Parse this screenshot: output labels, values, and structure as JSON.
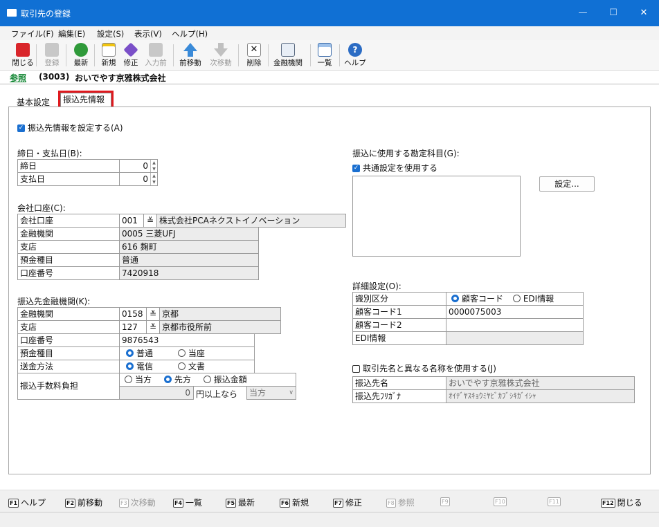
{
  "window": {
    "title": "取引先の登録"
  },
  "menu": [
    "ファイル(F)",
    "編集(E)",
    "設定(S)",
    "表示(V)",
    "ヘルプ(H)"
  ],
  "toolbar": [
    {
      "label": "閉じる",
      "icon": "close-icon",
      "color": "#d9262b",
      "enabled": true
    },
    {
      "label": "登録",
      "icon": "register-icon",
      "color": "#b8b8b8",
      "enabled": false
    },
    {
      "label": "最新",
      "icon": "refresh-icon",
      "color": "#2f9a3a",
      "enabled": true
    },
    {
      "label": "新規",
      "icon": "new-icon",
      "color": "#f1c40f",
      "enabled": true
    },
    {
      "label": "修正",
      "icon": "edit-icon",
      "color": "#7a4fc8",
      "enabled": true
    },
    {
      "label": "入力前",
      "icon": "undo-icon",
      "color": "#b8b8b8",
      "enabled": false
    },
    {
      "label": "前移動",
      "icon": "up-arrow-icon",
      "color": "#3a8ad8",
      "enabled": true
    },
    {
      "label": "次移動",
      "icon": "down-arrow-icon",
      "color": "#b8b8b8",
      "enabled": false
    },
    {
      "label": "削除",
      "icon": "delete-icon",
      "color": "#555555",
      "enabled": true
    },
    {
      "label": "金融機関",
      "icon": "bank-icon",
      "color": "#5a6a80",
      "enabled": true
    },
    {
      "label": "一覧",
      "icon": "list-icon",
      "color": "#3a6aa8",
      "enabled": true
    },
    {
      "label": "ヘルプ",
      "icon": "help-icon",
      "color": "#2b6cc4",
      "enabled": true
    }
  ],
  "ref": {
    "label": "参照",
    "code": "(3003)",
    "name": "おいでやす京雅株式会社"
  },
  "tabs": [
    "基本設定",
    "振込先情報"
  ],
  "enable_transfer": "振込先情報を設定する(A)",
  "closing": {
    "title": "締日・支払日(B):",
    "rows": [
      {
        "label": "締日",
        "value": "0"
      },
      {
        "label": "支払日",
        "value": "0"
      }
    ]
  },
  "company_account": {
    "title": "会社口座(C):",
    "rows": [
      {
        "label": "会社口座",
        "code": "001",
        "value": "株式会社PCAネクストイノベーション"
      },
      {
        "label": "金融機関",
        "value": "0005 三菱UFJ"
      },
      {
        "label": "支店",
        "value": "616 麹町"
      },
      {
        "label": "預金種目",
        "value": "普通"
      },
      {
        "label": "口座番号",
        "value": "7420918"
      }
    ]
  },
  "payee_bank": {
    "title": "振込先金融機関(K):",
    "bank": {
      "label": "金融機関",
      "code": "0158",
      "name": "京都"
    },
    "branch": {
      "label": "支店",
      "code": "127",
      "name": "京都市役所前"
    },
    "account": {
      "label": "口座番号",
      "value": "9876543"
    },
    "deposit": {
      "label": "預金種目",
      "options": [
        "普通",
        "当座"
      ],
      "selected": 0
    },
    "method": {
      "label": "送金方法",
      "options": [
        "電信",
        "文書"
      ],
      "selected": 0
    },
    "fee": {
      "label": "振込手数料負担",
      "options": [
        "当方",
        "先方",
        "振込金額"
      ],
      "selected": 1,
      "amount": "0",
      "suffix": "円以上なら",
      "select": "当方"
    }
  },
  "subject": {
    "title": "振込に使用する勘定科目(G):",
    "common": "共通設定を使用する",
    "button": "設定..."
  },
  "detail": {
    "title": "詳細設定(O):",
    "id_type": {
      "label": "識別区分",
      "options": [
        "顧客コード",
        "EDI情報"
      ],
      "selected": 0
    },
    "rows": [
      {
        "label": "顧客コード1",
        "value": "0000075003"
      },
      {
        "label": "顧客コード2",
        "value": ""
      },
      {
        "label": "EDI情報",
        "value": ""
      }
    ]
  },
  "alt_name": {
    "checkbox": "取引先名と異なる名称を使用する(J)",
    "rows": [
      {
        "label": "振込先名",
        "value": "おいでやす京雅株式会社"
      },
      {
        "label": "振込先ﾌﾘｶﾞﾅ",
        "value": "ｵｲﾃﾞﾔｽｷｮｳﾐﾔﾋﾞｶﾌﾞｼｷｶﾞｲｼｬ"
      }
    ]
  },
  "fkeys": [
    {
      "key": "F1",
      "label": "ヘルプ",
      "enabled": true
    },
    {
      "key": "F2",
      "label": "前移動",
      "enabled": true
    },
    {
      "key": "F3",
      "label": "次移動",
      "enabled": false
    },
    {
      "key": "F4",
      "label": "一覧",
      "enabled": true
    },
    {
      "key": "F5",
      "label": "最新",
      "enabled": true
    },
    {
      "key": "F6",
      "label": "新規",
      "enabled": true
    },
    {
      "key": "F7",
      "label": "修正",
      "enabled": true
    },
    {
      "key": "F8",
      "label": "参照",
      "enabled": false
    },
    {
      "key": "F9",
      "label": "",
      "enabled": false
    },
    {
      "key": "F10",
      "label": "",
      "enabled": false
    },
    {
      "key": "F11",
      "label": "",
      "enabled": false
    },
    {
      "key": "F12",
      "label": "閉じる",
      "enabled": true
    }
  ],
  "colors": {
    "titlebar": "#1070d4",
    "highlight": "#e0191e",
    "accent": "#1a6fd0"
  }
}
